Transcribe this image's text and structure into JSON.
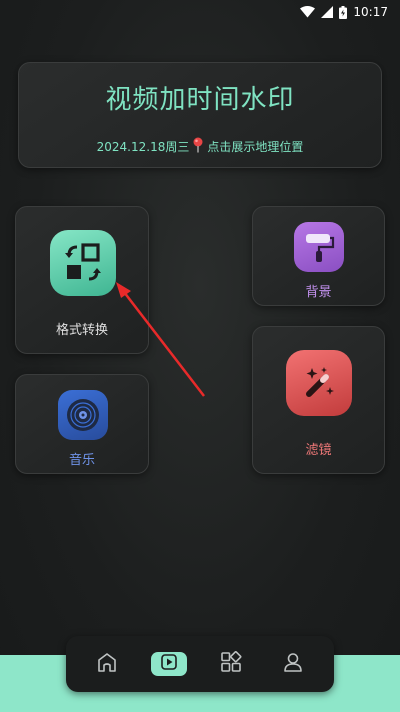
{
  "status_bar": {
    "time": "10:17"
  },
  "header": {
    "title": "视频加时间水印",
    "date": "2024.12.18周三",
    "location_hint": "点击展示地理位置"
  },
  "tiles": {
    "format": {
      "label": "格式转换",
      "icon": "format-convert-icon",
      "color": "#5fcfa8"
    },
    "music": {
      "label": "音乐",
      "icon": "music-disc-icon",
      "color": "#3b6fd6"
    },
    "background": {
      "label": "背景",
      "icon": "paint-roller-icon",
      "color": "#a566dc"
    },
    "filter": {
      "label": "滤镜",
      "icon": "magic-wand-icon",
      "color": "#e05353"
    }
  },
  "nav": {
    "items": [
      {
        "icon": "home-icon",
        "active": false
      },
      {
        "icon": "play-icon",
        "active": true
      },
      {
        "icon": "grid-icon",
        "active": false
      },
      {
        "icon": "user-icon",
        "active": false
      }
    ]
  },
  "colors": {
    "accent": "#8ee6c9",
    "title": "#7fe3c2"
  }
}
